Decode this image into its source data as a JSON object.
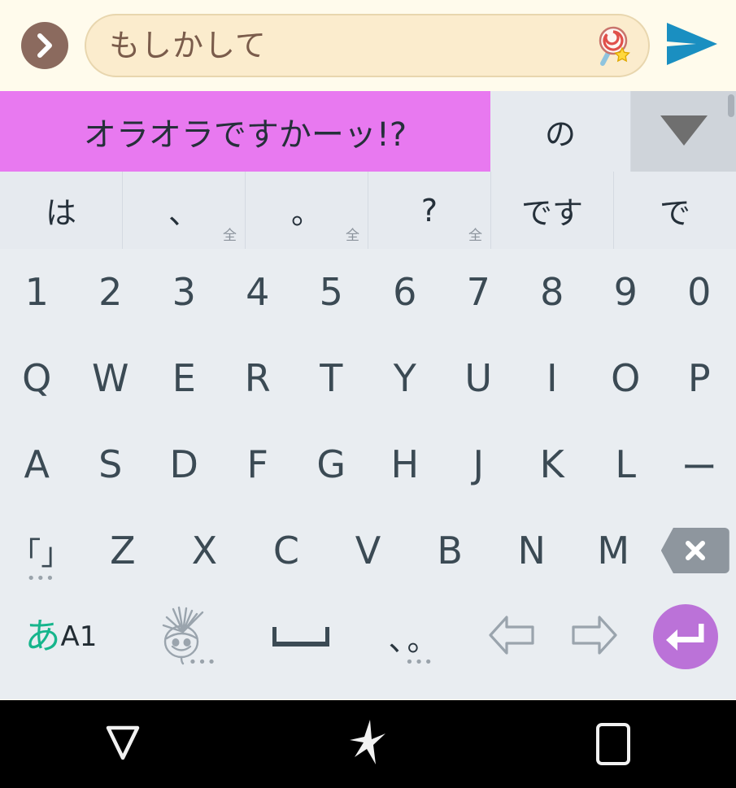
{
  "topbar": {
    "expand_button_icon": "chevron-right-icon",
    "input_value": "もしかして",
    "input_placeholder": "",
    "decoration_icon": "lollipop-icon",
    "send_icon": "send-arrow-icon"
  },
  "candidates": {
    "row1": [
      {
        "label": "オラオラですかーッ!?",
        "selected": true
      },
      {
        "label": "の",
        "selected": false
      }
    ],
    "expand_icon": "chevron-down-icon",
    "row2": [
      {
        "label": "は",
        "marker": ""
      },
      {
        "label": "、",
        "marker": "全"
      },
      {
        "label": "。",
        "marker": "全"
      },
      {
        "label": "?",
        "marker": "全"
      },
      {
        "label": "です",
        "marker": ""
      },
      {
        "label": "で",
        "marker": ""
      }
    ]
  },
  "keyboard": {
    "row_numbers": [
      "1",
      "2",
      "3",
      "4",
      "5",
      "6",
      "7",
      "8",
      "9",
      "0"
    ],
    "row_q": [
      "Q",
      "W",
      "E",
      "R",
      "T",
      "Y",
      "U",
      "I",
      "O",
      "P"
    ],
    "row_a": [
      "A",
      "S",
      "D",
      "F",
      "G",
      "H",
      "J",
      "K",
      "L",
      "ー"
    ],
    "row_z": {
      "bracket_key": {
        "label": "「」",
        "dots": "•••"
      },
      "letters": [
        "Z",
        "X",
        "C",
        "V",
        "B",
        "N",
        "M"
      ],
      "backspace_icon": "backspace-icon"
    },
    "function_row": {
      "mode_key": {
        "kana": "あ",
        "alnum": "A1"
      },
      "emoji_key": {
        "icon": "emoticon-icon",
        "dots": "•••"
      },
      "space_key": {
        "icon": "space-bar-icon"
      },
      "punct_key": {
        "label": "、。",
        "dots": "•••"
      },
      "cursor_left_icon": "arrow-left-icon",
      "cursor_right_icon": "arrow-right-icon",
      "enter_icon": "enter-arrow-icon"
    }
  },
  "navbar": {
    "back_icon": "back-triangle-icon",
    "home_icon": "home-star-icon",
    "recents_icon": "recents-square-icon"
  },
  "colors": {
    "accent_candidate": "#e879f0",
    "enter_key": "#bb72d8",
    "input_field": "#fbeccd",
    "input_text": "#7a5c4b",
    "send_arrow": "#1a8fc1",
    "key_text": "#3b4a54",
    "kana_mode": "#16b58c",
    "keyboard_bg": "#e9edf1",
    "navbar_bg": "#000000"
  }
}
